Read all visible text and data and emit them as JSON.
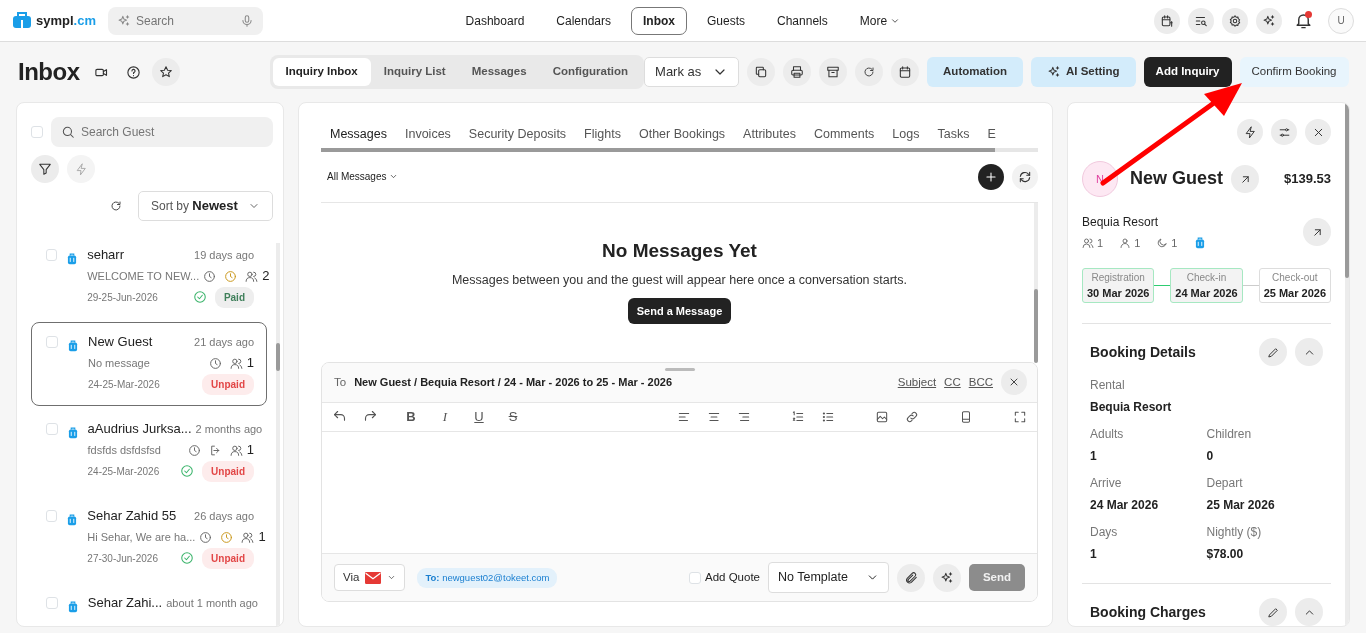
{
  "topbar": {
    "brand": "sympl",
    "brand_suffix": ".cm",
    "search": {
      "placeholder": "Search"
    },
    "nav": [
      {
        "label": "Dashboard",
        "kind": "link",
        "selected": false
      },
      {
        "label": "Calendars",
        "kind": "link",
        "selected": false
      },
      {
        "label": "Inbox",
        "kind": "link",
        "selected": true
      },
      {
        "label": "Guests",
        "kind": "link",
        "selected": false
      },
      {
        "label": "Channels",
        "kind": "link",
        "selected": false
      },
      {
        "label": "More",
        "kind": "dropdown",
        "selected": false
      }
    ],
    "notifications": {
      "unread": true
    },
    "user": {
      "initial": "U"
    }
  },
  "header": {
    "title": "Inbox",
    "tabs": [
      {
        "label": "Inquiry Inbox",
        "selected": true
      },
      {
        "label": "Inquiry List",
        "selected": false
      },
      {
        "label": "Messages",
        "selected": false
      },
      {
        "label": "Configuration",
        "selected": false
      }
    ],
    "mark_as": "Mark as",
    "buttons": [
      {
        "label": "Automation",
        "kind": "sky"
      },
      {
        "label": "AI Setting",
        "kind": "sky-sparkle"
      },
      {
        "label": "Add Inquiry",
        "kind": "dark"
      },
      {
        "label": "Confirm Booking",
        "kind": "pale"
      }
    ]
  },
  "inquiries": {
    "select_all": {
      "checked": false
    },
    "search_placeholder": "Search Guest",
    "sort_label": "Sort by",
    "sort_value": "Newest",
    "items": [
      {
        "name": "seharr",
        "time": "19 days ago",
        "preview": "WELCOME TO NEW...",
        "dates": "29-25-Jun-2026",
        "guests": "2",
        "alarm": true,
        "exit": false,
        "verified": true,
        "payment": "Paid",
        "paid": true,
        "selected": false,
        "checked": false
      },
      {
        "name": "New Guest",
        "time": "21 days ago",
        "preview": "No message",
        "dates": "24-25-Mar-2026",
        "guests": "1",
        "alarm": false,
        "exit": false,
        "verified": false,
        "payment": "Unpaid",
        "paid": false,
        "selected": true,
        "checked": false
      },
      {
        "name": "aAudrius Jurksa...",
        "time": "2 months ago",
        "preview": "fdsfds dsfdsfsd",
        "dates": "24-25-Mar-2026",
        "guests": "1",
        "alarm": false,
        "exit": true,
        "verified": true,
        "payment": "Unpaid",
        "paid": false,
        "selected": false,
        "checked": false
      },
      {
        "name": "Sehar Zahid 55",
        "time": "26 days ago",
        "preview": "Hi Sehar, We are ha...",
        "dates": "27-30-Jun-2026",
        "guests": "1",
        "alarm": true,
        "exit": false,
        "verified": true,
        "payment": "Unpaid",
        "paid": false,
        "selected": false,
        "checked": false
      },
      {
        "name": "Sehar Zahi...",
        "time": "about 1 month ago",
        "selected": false,
        "checked": false
      }
    ]
  },
  "conversation": {
    "tabs": [
      {
        "label": "Messages",
        "selected": true
      },
      {
        "label": "Invoices",
        "selected": false
      },
      {
        "label": "Security Deposits",
        "selected": false
      },
      {
        "label": "Flights",
        "selected": false
      },
      {
        "label": "Other Bookings",
        "selected": false
      },
      {
        "label": "Attributes",
        "selected": false
      },
      {
        "label": "Comments",
        "selected": false
      },
      {
        "label": "Logs",
        "selected": false
      },
      {
        "label": "Tasks",
        "selected": false
      },
      {
        "label": "E",
        "selected": false
      }
    ],
    "filter": "All Messages",
    "empty": {
      "title": "No Messages Yet",
      "text": "Messages between you and the guest will appear here once a conversation starts.",
      "button": "Send a Message"
    },
    "composer": {
      "to_label": "To",
      "to": "New Guest / Bequia Resort / 24 - Mar - 2026 to 25 - Mar - 2026",
      "links": [
        "Subject",
        "CC",
        "BCC"
      ],
      "text_styles": [
        {
          "kind": "bold",
          "label": "B"
        },
        {
          "kind": "italic",
          "label": "I"
        },
        {
          "kind": "underline",
          "label": "U"
        },
        {
          "kind": "strike",
          "label": "S"
        }
      ],
      "via": "Via",
      "recipient": "**To:** newguest02@tokeet.com",
      "add_quote": {
        "label": "Add Quote",
        "checked": false
      },
      "template": "No Template",
      "send": {
        "label": "Send",
        "disabled": true
      }
    }
  },
  "booking": {
    "initial": "N",
    "name": "New Guest",
    "total": "$139.53",
    "rental": "Bequia Resort",
    "stats": [
      {
        "kind": "guests",
        "value": "1"
      },
      {
        "kind": "adults",
        "value": "1"
      },
      {
        "kind": "nights",
        "value": "1"
      }
    ],
    "timeline": [
      {
        "label": "Registration",
        "date": "30 Mar 2026",
        "done": true
      },
      {
        "label": "Check-in",
        "date": "24 Mar 2026",
        "done": true
      },
      {
        "label": "Check-out",
        "date": "25 Mar 2026",
        "done": false
      }
    ],
    "sections": [
      {
        "title": "Booking Details",
        "expanded": true,
        "fields": [
          {
            "label": "Rental",
            "value": "Bequia Resort"
          },
          {
            "label": "Adults",
            "value": "1"
          },
          {
            "label": "Children",
            "value": "0"
          },
          {
            "label": "Arrive",
            "value": "24 Mar 2026"
          },
          {
            "label": "Depart",
            "value": "25 Mar 2026"
          },
          {
            "label": "Days",
            "value": "1"
          },
          {
            "label": "Nightly ($)",
            "value": "$78.00"
          }
        ]
      },
      {
        "title": "Booking Charges",
        "expanded": true
      }
    ]
  }
}
